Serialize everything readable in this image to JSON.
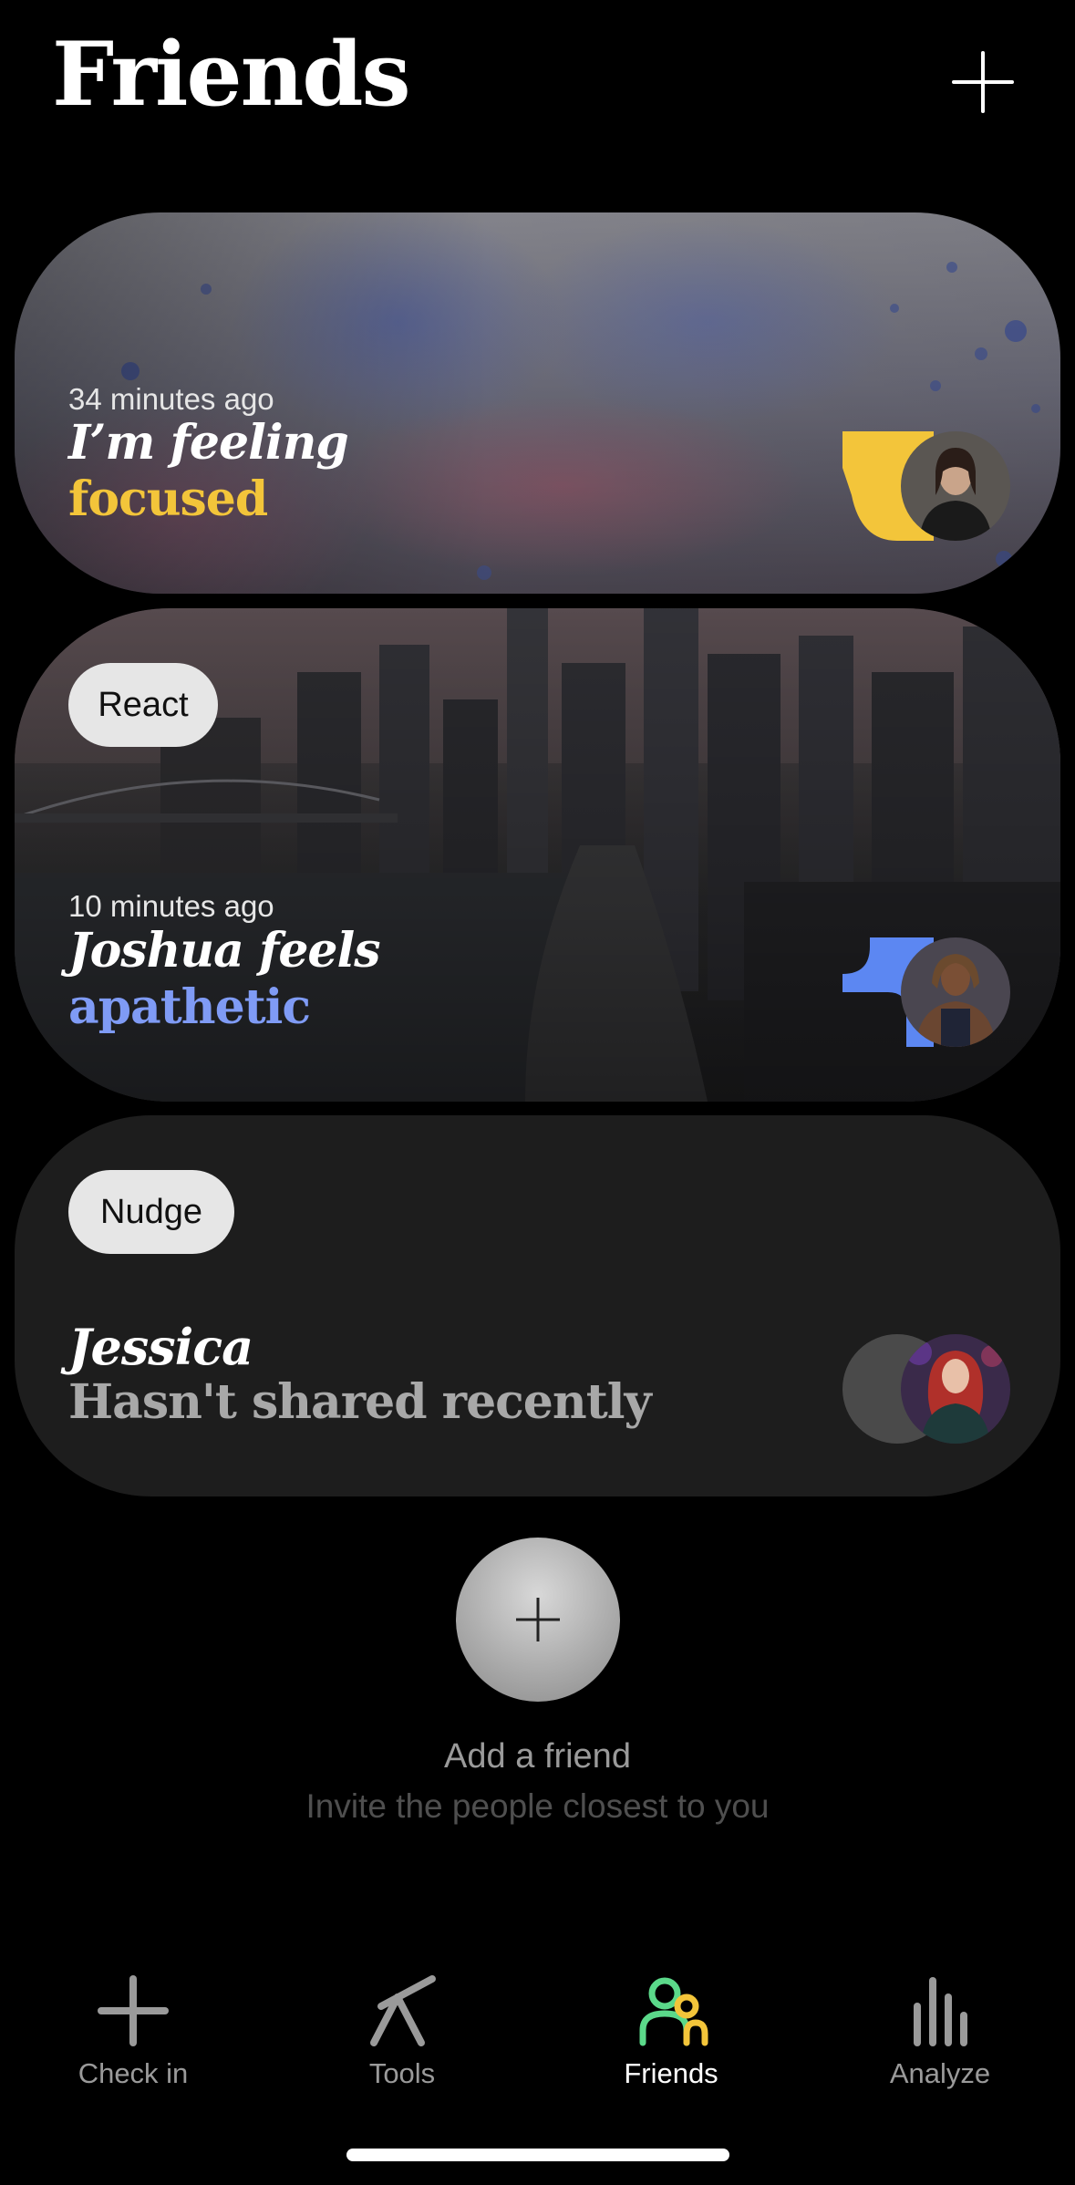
{
  "header": {
    "title": "Friends",
    "add_icon": "plus-icon"
  },
  "cards": [
    {
      "time": "34 minutes ago",
      "headline": "I’m feeling",
      "mood": "focused",
      "mood_color": "#F3C53A",
      "accent_color": "#F3C53A"
    },
    {
      "action": "React",
      "time": "10 minutes ago",
      "headline": "Joshua feels",
      "mood": "apathetic",
      "mood_color": "#7F9BF5",
      "accent_color": "#5C87F2"
    },
    {
      "action": "Nudge",
      "headline": "Jessica",
      "status": "Hasn't shared recently",
      "status_color": "#A8A8A8"
    }
  ],
  "add_friend": {
    "icon": "plus-icon",
    "title": "Add a friend",
    "subtitle": "Invite the people closest to you"
  },
  "tab_bar": {
    "tabs": [
      {
        "label": "Check in",
        "icon": "plus-icon",
        "active": false
      },
      {
        "label": "Tools",
        "icon": "tools-icon",
        "active": false
      },
      {
        "label": "Friends",
        "icon": "friends-icon",
        "active": true
      },
      {
        "label": "Analyze",
        "icon": "bar-chart-icon",
        "active": false
      }
    ]
  },
  "colors": {
    "background": "#000000",
    "friends_tab_green": "#5BD98A",
    "friends_tab_yellow": "#F3C53A"
  }
}
